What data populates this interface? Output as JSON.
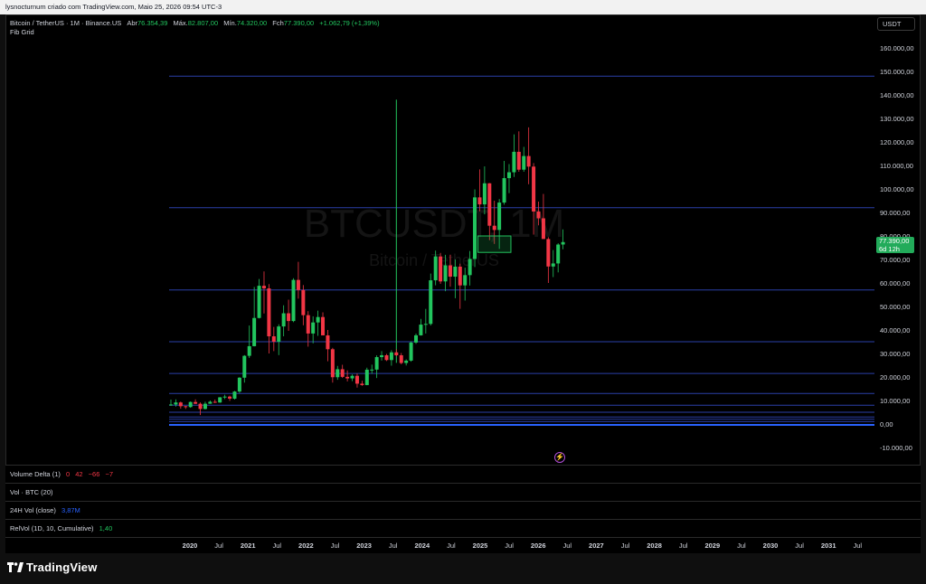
{
  "attribution": "lysnocturnum criado com TradingView.com, Maio 25, 2026 09:54 UTC-3",
  "legend": {
    "symbol": "Bitcoin / TetherUS · 1M · Binance.US",
    "open_label": "Abr",
    "open_value": "76.354,39",
    "high_label": "Máx.",
    "high_value": "82.807,00",
    "low_label": "Mín.",
    "low_value": "74.320,00",
    "close_label": "Fch",
    "close_value": "77.390,00",
    "change": "+1.062,79 (+1,39%)",
    "indicator": "Fib Grid"
  },
  "currency_button": "USDT",
  "watermark": {
    "symbol": "BTCUSDT, 1M",
    "subtitle": "Bitcoin / TetherUS"
  },
  "price_axis": {
    "labels": [
      "160.000,00",
      "150.000,00",
      "140.000,00",
      "130.000,00",
      "120.000,00",
      "110.000,00",
      "100.000,00",
      "90.000,00",
      "80.000,00",
      "70.000,00",
      "60.000,00",
      "50.000,00",
      "40.000,00",
      "30.000,00",
      "20.000,00",
      "10.000,00",
      "0,00",
      "-10.000,00"
    ],
    "values": [
      160000,
      150000,
      140000,
      130000,
      120000,
      110000,
      100000,
      90000,
      80000,
      70000,
      60000,
      50000,
      40000,
      30000,
      20000,
      10000,
      0,
      -10000
    ],
    "current_price": "77.390,00",
    "countdown": "6d 12h"
  },
  "fib_levels": [
    148000,
    92000,
    57000,
    35000,
    21500,
    13000,
    8000,
    5000,
    3000,
    2000,
    1000
  ],
  "panes": [
    {
      "name": "Volume Delta (1)",
      "values": [
        "0",
        "42",
        "−66",
        "−7"
      ]
    },
    {
      "name": "Vol · BTC (20)",
      "values": []
    },
    {
      "name": "24H Vol (close)",
      "values": [
        "3,87M"
      ]
    },
    {
      "name": "RelVol (1D, 10, Cumulative)",
      "values": [
        "1,40"
      ]
    }
  ],
  "time_axis": [
    {
      "label": "2020",
      "bold": true
    },
    {
      "label": "Jul",
      "bold": false
    },
    {
      "label": "2021",
      "bold": true
    },
    {
      "label": "Jul",
      "bold": false
    },
    {
      "label": "2022",
      "bold": true
    },
    {
      "label": "Jul",
      "bold": false
    },
    {
      "label": "2023",
      "bold": true
    },
    {
      "label": "Jul",
      "bold": false
    },
    {
      "label": "2024",
      "bold": true
    },
    {
      "label": "Jul",
      "bold": false
    },
    {
      "label": "2025",
      "bold": true
    },
    {
      "label": "Jul",
      "bold": false
    },
    {
      "label": "2026",
      "bold": true
    },
    {
      "label": "Jul",
      "bold": false
    },
    {
      "label": "2027",
      "bold": true
    },
    {
      "label": "Jul",
      "bold": false
    },
    {
      "label": "2028",
      "bold": true
    },
    {
      "label": "Jul",
      "bold": false
    },
    {
      "label": "2029",
      "bold": true
    },
    {
      "label": "Jul",
      "bold": false
    },
    {
      "label": "2030",
      "bold": true
    },
    {
      "label": "Jul",
      "bold": false
    },
    {
      "label": "2031",
      "bold": true
    },
    {
      "label": "Jul",
      "bold": false
    }
  ],
  "brand": "TradingView",
  "colors": {
    "up": "#22c55e",
    "down": "#f23645",
    "fib": "#2a3fa8",
    "background": "#000000"
  },
  "chart_data": {
    "type": "candlestick",
    "start": "2019-09",
    "interval": "1M",
    "ohlc": [
      [
        8300,
        10400,
        7700,
        8300
      ],
      [
        8300,
        10500,
        7400,
        9150
      ],
      [
        9150,
        9550,
        6500,
        7550
      ],
      [
        7550,
        7700,
        6400,
        7200
      ],
      [
        7200,
        9600,
        6900,
        9350
      ],
      [
        9350,
        10500,
        8500,
        8600
      ],
      [
        8600,
        9200,
        3800,
        6400
      ],
      [
        6400,
        9450,
        6150,
        8620
      ],
      [
        8620,
        10000,
        8600,
        9450
      ],
      [
        9450,
        10400,
        8900,
        9140
      ],
      [
        9140,
        11450,
        9000,
        11350
      ],
      [
        11350,
        12450,
        10600,
        11650
      ],
      [
        11650,
        12050,
        9800,
        10780
      ],
      [
        10780,
        14100,
        10400,
        13800
      ],
      [
        13800,
        19900,
        13200,
        19700
      ],
      [
        19700,
        29300,
        17600,
        29000
      ],
      [
        29000,
        41900,
        28100,
        33100
      ],
      [
        33100,
        58300,
        33000,
        45100
      ],
      [
        45100,
        61700,
        44900,
        58800
      ],
      [
        58800,
        64900,
        47000,
        57700
      ],
      [
        57700,
        59500,
        30000,
        37300
      ],
      [
        37300,
        41300,
        31000,
        35000
      ],
      [
        35000,
        42400,
        29300,
        41500
      ],
      [
        41500,
        50500,
        37300,
        47100
      ],
      [
        47100,
        52900,
        39600,
        43800
      ],
      [
        43800,
        62000,
        43300,
        61300
      ],
      [
        61300,
        69000,
        53300,
        57000
      ],
      [
        57000,
        59100,
        42000,
        46300
      ],
      [
        46300,
        48000,
        32900,
        38500
      ],
      [
        38500,
        45800,
        34300,
        43200
      ],
      [
        43200,
        48200,
        37500,
        45500
      ],
      [
        45500,
        47500,
        37700,
        37700
      ],
      [
        37700,
        40000,
        26700,
        31800
      ],
      [
        31800,
        32400,
        17600,
        19900
      ],
      [
        19900,
        24700,
        18800,
        23300
      ],
      [
        23300,
        25200,
        19600,
        20050
      ],
      [
        20050,
        22800,
        18100,
        19400
      ],
      [
        19400,
        21100,
        18200,
        20500
      ],
      [
        20500,
        21500,
        15500,
        17150
      ],
      [
        17150,
        18400,
        16250,
        16550
      ],
      [
        16550,
        23950,
        16500,
        23100
      ],
      [
        23100,
        25250,
        21350,
        23150
      ],
      [
        23150,
        29200,
        19550,
        28450
      ],
      [
        28450,
        31000,
        26950,
        29250
      ],
      [
        29250,
        29800,
        26800,
        27200
      ],
      [
        27200,
        31400,
        24800,
        30470
      ],
      [
        30470,
        31800,
        28850,
        29230
      ],
      [
        29230,
        30200,
        25400,
        25950
      ],
      [
        25950,
        27500,
        24900,
        26960
      ],
      [
        26960,
        35200,
        26500,
        34640
      ],
      [
        34640,
        38450,
        34100,
        37720
      ],
      [
        37720,
        44700,
        37600,
        42280
      ],
      [
        42280,
        48970,
        38500,
        42580
      ],
      [
        42580,
        64000,
        41900,
        61130
      ],
      [
        61130,
        73780,
        59000,
        71280
      ],
      [
        71280,
        72800,
        59600,
        60660
      ],
      [
        60660,
        71980,
        56500,
        67490
      ],
      [
        67490,
        72000,
        58400,
        62680
      ],
      [
        62680,
        70000,
        53500,
        66950
      ],
      [
        66950,
        68200,
        49000,
        58970
      ],
      [
        58970,
        66500,
        52500,
        63330
      ],
      [
        63330,
        73600,
        58900,
        70210
      ],
      [
        70210,
        99800,
        66800,
        96410
      ],
      [
        96410,
        108300,
        90500,
        93430
      ],
      [
        93430,
        109600,
        89200,
        102400
      ],
      [
        102400,
        102500,
        78200,
        84350
      ],
      [
        84350,
        95000,
        76600,
        82550
      ],
      [
        82550,
        95700,
        74500,
        94200
      ],
      [
        94200,
        111900,
        93300,
        104600
      ],
      [
        104600,
        110600,
        98200,
        107100
      ],
      [
        107100,
        123200,
        105100,
        115800
      ],
      [
        115800,
        124500,
        107300,
        108200
      ],
      [
        108200,
        117900,
        107300,
        114000
      ],
      [
        114000,
        126200,
        102000,
        109500
      ],
      [
        109500,
        111000,
        80600,
        90400
      ],
      [
        90400,
        94600,
        84500,
        87500
      ],
      [
        87500,
        97900,
        81000,
        78700
      ],
      [
        78700,
        79500,
        60000,
        67000
      ],
      [
        67000,
        74000,
        62500,
        68300
      ],
      [
        68300,
        76900,
        64500,
        76350
      ],
      [
        76350,
        82807,
        74320,
        77390
      ]
    ],
    "ylim": [
      -10000,
      165000
    ]
  }
}
